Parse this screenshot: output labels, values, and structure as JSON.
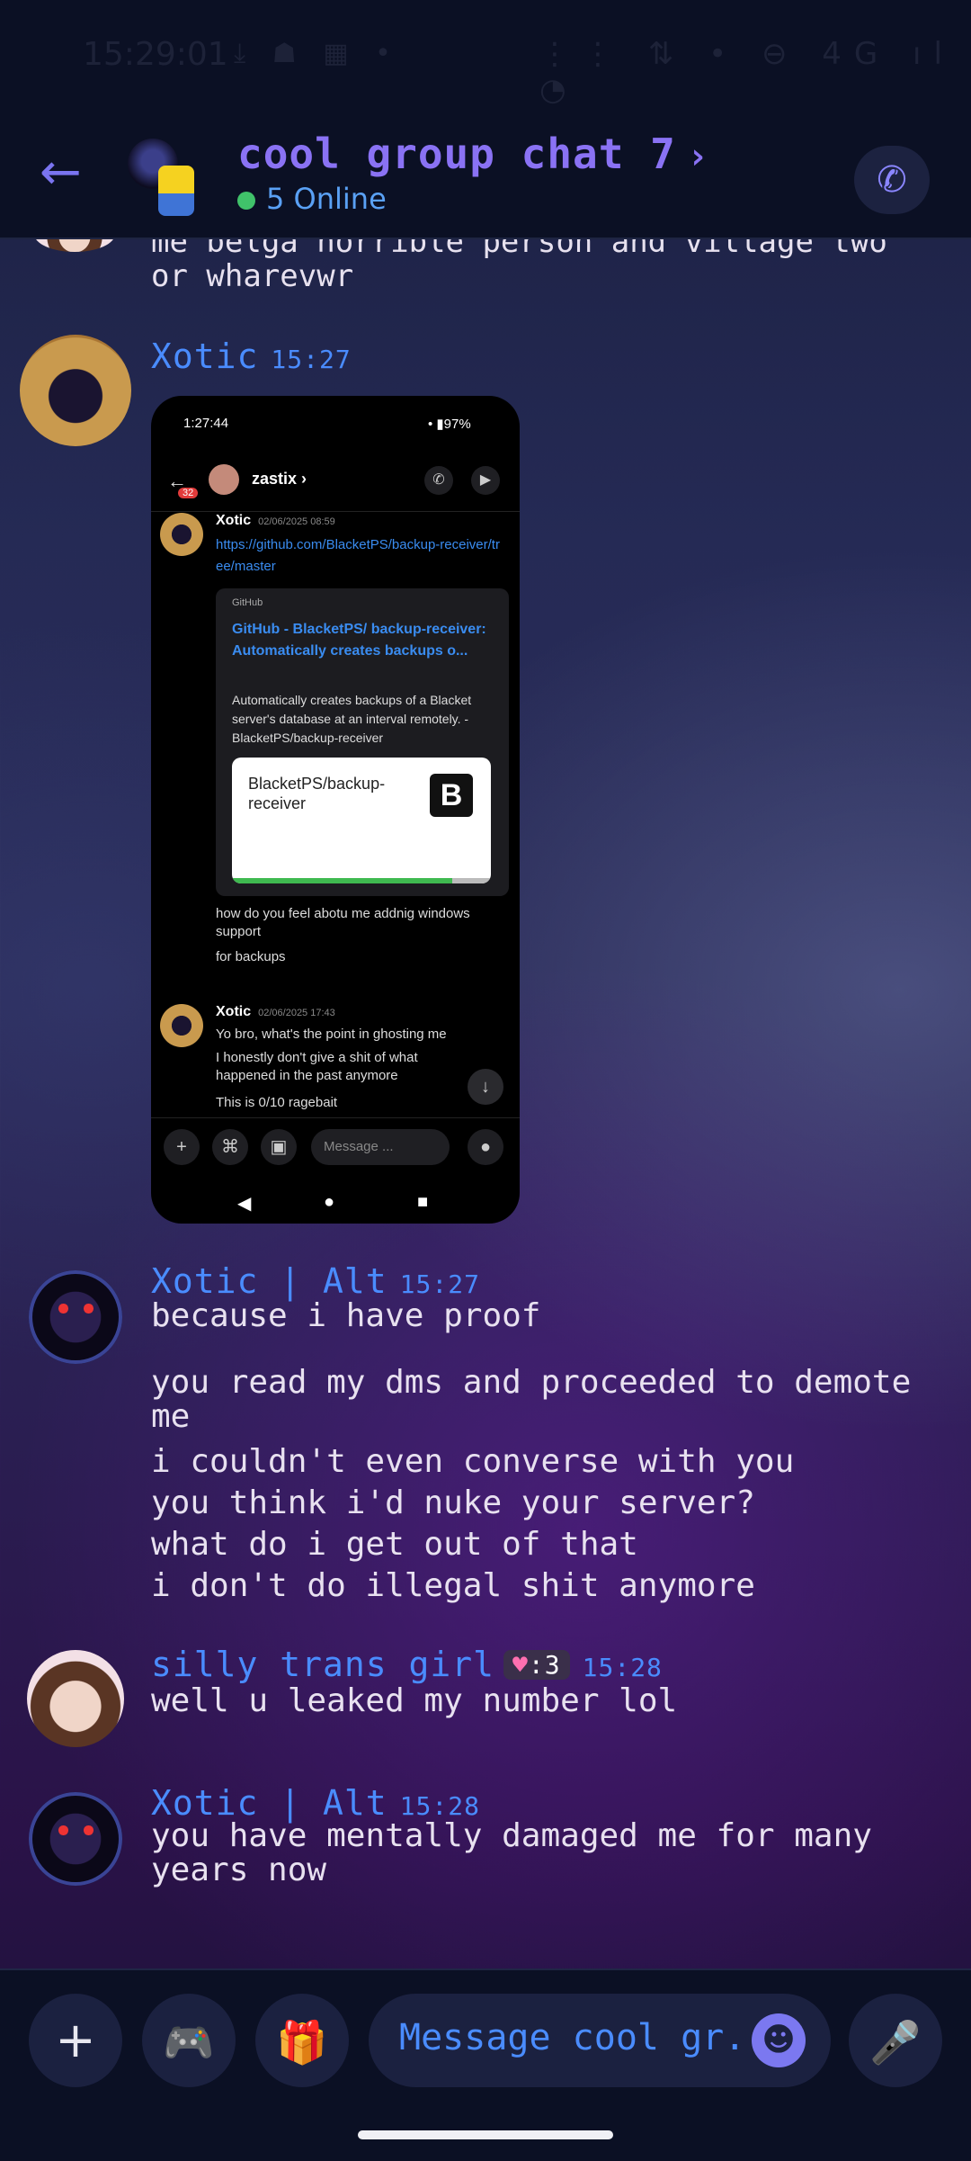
{
  "status": {
    "time": "15:29:01",
    "left_icons": "⤓ ☗ ▦ •",
    "right_icons": "⋮⋮ ⇅ • ⊖ 4G ıl ◔"
  },
  "header": {
    "title": "cool group chat 7",
    "chevron": "›",
    "online": "5 Online",
    "back_icon": "arrow-left",
    "call_icon": "phone"
  },
  "previous_message": {
    "text": "me belga horrible person and village two or wharevwr"
  },
  "messages": [
    {
      "author": "Xotic",
      "time": "15:27"
    },
    {
      "author": "Xotic | Alt",
      "time": "15:27",
      "lines": [
        "because i have proof",
        "",
        "you read my dms and proceeded to demote me",
        "i couldn't even converse with you",
        "you think i'd nuke your server?",
        "what do i get out of that",
        "i don't do illegal shit anymore"
      ]
    },
    {
      "author": "silly trans girl",
      "badge": ":3",
      "time": "15:28",
      "lines": [
        "well u leaked my number lol"
      ]
    },
    {
      "author": "Xotic | Alt",
      "time": "15:28",
      "lines": [
        "you have mentally damaged me for many years now"
      ]
    }
  ],
  "screenshot": {
    "status_time": "1:27:44",
    "status_right": "• ▮97%",
    "unread": "32",
    "chat_name": "zastix ›",
    "m1": {
      "author": "Xotic",
      "date": "02/06/2025 08:59",
      "link": "https://github.com/BlacketPS/backup-receiver/tree/master"
    },
    "card": {
      "provider": "GitHub",
      "title": "GitHub - BlacketPS/ backup-receiver: Automatically creates backups o...",
      "desc": "Automatically creates backups of a Blacket server's database at an interval remotely. - BlacketPS/backup-receiver",
      "repo": "BlacketPS/backup-receiver",
      "logo": "B"
    },
    "followups": [
      "how do you feel abotu me addnig windows support",
      "for backups"
    ],
    "m2": {
      "author": "Xotic",
      "date": "02/06/2025 17:43",
      "lines": [
        "Yo bro, what's the point in ghosting me",
        "I honestly don't give a shit of what happened in the past anymore",
        "This is 0/10 ragebait"
      ]
    },
    "placeholder": "Message ..."
  },
  "composer": {
    "placeholder": "Message cool gr...",
    "icons": [
      "plus-icon",
      "gamepad-icon",
      "gift-icon",
      "emoji-icon",
      "mic-icon"
    ]
  },
  "colors": {
    "accent": "#8a72f4",
    "name_blue": "#4a8cff",
    "online_green": "#40c26a"
  }
}
